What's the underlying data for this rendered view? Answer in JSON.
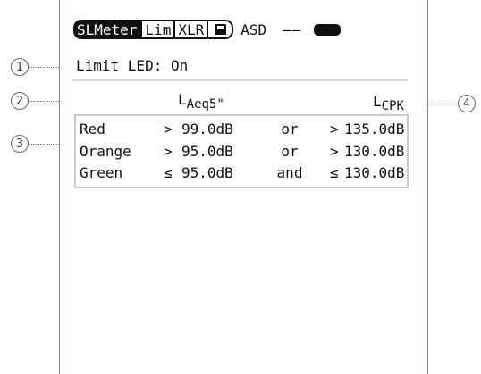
{
  "status_bar": {
    "mode_label": "SLMeter",
    "limit_tab": "Lim",
    "xlr_tab": "XLR",
    "save_icon": "save-icon",
    "asd_label": "ASD",
    "dashes": "——",
    "battery_icon": "battery-icon"
  },
  "limit_led": {
    "text": "Limit LED: On"
  },
  "headers": {
    "leq_main": "L",
    "leq_sub": "Aeq5\"",
    "lcpk_main": "L",
    "lcpk_sub": "CPK"
  },
  "limits_table": [
    {
      "name": "Red",
      "op1": ">",
      "val1": "99.0dB",
      "conj": "or",
      "op2": ">",
      "val2": "135.0dB"
    },
    {
      "name": "Orange",
      "op1": ">",
      "val1": "95.0dB",
      "conj": "or",
      "op2": ">",
      "val2": "130.0dB"
    },
    {
      "name": "Green",
      "op1": "≤",
      "val1": "95.0dB",
      "conj": "and",
      "op2": "≤",
      "val2": "130.0dB"
    }
  ],
  "callouts": [
    "1",
    "2",
    "3",
    "4"
  ],
  "colors": {
    "frame": "#6f8fae",
    "table_border": "#c9c9c9",
    "divider": "#d8d8d8"
  }
}
